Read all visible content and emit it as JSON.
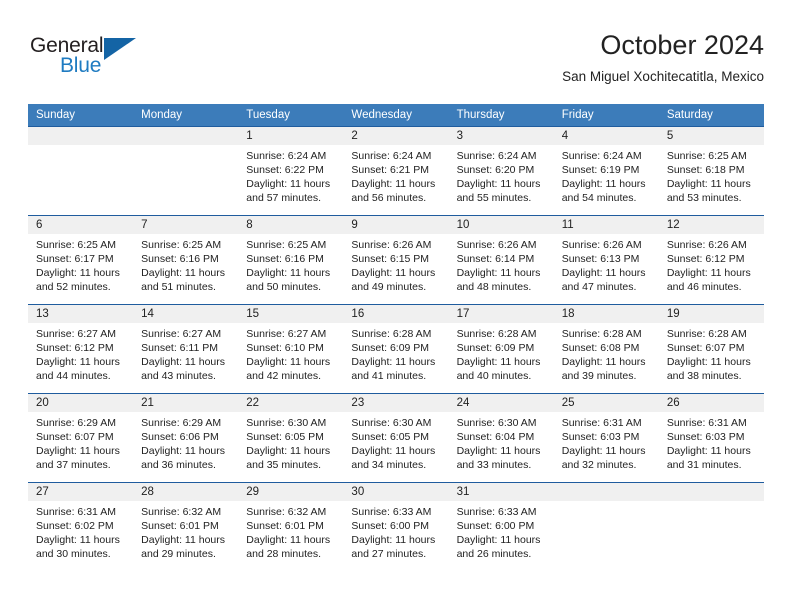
{
  "brand": {
    "name_part1": "General",
    "name_part2": "Blue",
    "accent_color": "#1f7bc1",
    "triangle_color": "#1464a5"
  },
  "header": {
    "title": "October 2024",
    "subtitle": "San Miguel Xochitecatitla, Mexico"
  },
  "calendar": {
    "header_bg": "#3c7cba",
    "row_divider_color": "#1f5c9e",
    "daynum_bg": "#f0f0f0",
    "weekday_headers": [
      "Sunday",
      "Monday",
      "Tuesday",
      "Wednesday",
      "Thursday",
      "Friday",
      "Saturday"
    ],
    "weeks": [
      [
        {
          "day": "",
          "lines": []
        },
        {
          "day": "",
          "lines": []
        },
        {
          "day": "1",
          "lines": [
            "Sunrise: 6:24 AM",
            "Sunset: 6:22 PM",
            "Daylight: 11 hours",
            "and 57 minutes."
          ]
        },
        {
          "day": "2",
          "lines": [
            "Sunrise: 6:24 AM",
            "Sunset: 6:21 PM",
            "Daylight: 11 hours",
            "and 56 minutes."
          ]
        },
        {
          "day": "3",
          "lines": [
            "Sunrise: 6:24 AM",
            "Sunset: 6:20 PM",
            "Daylight: 11 hours",
            "and 55 minutes."
          ]
        },
        {
          "day": "4",
          "lines": [
            "Sunrise: 6:24 AM",
            "Sunset: 6:19 PM",
            "Daylight: 11 hours",
            "and 54 minutes."
          ]
        },
        {
          "day": "5",
          "lines": [
            "Sunrise: 6:25 AM",
            "Sunset: 6:18 PM",
            "Daylight: 11 hours",
            "and 53 minutes."
          ]
        }
      ],
      [
        {
          "day": "6",
          "lines": [
            "Sunrise: 6:25 AM",
            "Sunset: 6:17 PM",
            "Daylight: 11 hours",
            "and 52 minutes."
          ]
        },
        {
          "day": "7",
          "lines": [
            "Sunrise: 6:25 AM",
            "Sunset: 6:16 PM",
            "Daylight: 11 hours",
            "and 51 minutes."
          ]
        },
        {
          "day": "8",
          "lines": [
            "Sunrise: 6:25 AM",
            "Sunset: 6:16 PM",
            "Daylight: 11 hours",
            "and 50 minutes."
          ]
        },
        {
          "day": "9",
          "lines": [
            "Sunrise: 6:26 AM",
            "Sunset: 6:15 PM",
            "Daylight: 11 hours",
            "and 49 minutes."
          ]
        },
        {
          "day": "10",
          "lines": [
            "Sunrise: 6:26 AM",
            "Sunset: 6:14 PM",
            "Daylight: 11 hours",
            "and 48 minutes."
          ]
        },
        {
          "day": "11",
          "lines": [
            "Sunrise: 6:26 AM",
            "Sunset: 6:13 PM",
            "Daylight: 11 hours",
            "and 47 minutes."
          ]
        },
        {
          "day": "12",
          "lines": [
            "Sunrise: 6:26 AM",
            "Sunset: 6:12 PM",
            "Daylight: 11 hours",
            "and 46 minutes."
          ]
        }
      ],
      [
        {
          "day": "13",
          "lines": [
            "Sunrise: 6:27 AM",
            "Sunset: 6:12 PM",
            "Daylight: 11 hours",
            "and 44 minutes."
          ]
        },
        {
          "day": "14",
          "lines": [
            "Sunrise: 6:27 AM",
            "Sunset: 6:11 PM",
            "Daylight: 11 hours",
            "and 43 minutes."
          ]
        },
        {
          "day": "15",
          "lines": [
            "Sunrise: 6:27 AM",
            "Sunset: 6:10 PM",
            "Daylight: 11 hours",
            "and 42 minutes."
          ]
        },
        {
          "day": "16",
          "lines": [
            "Sunrise: 6:28 AM",
            "Sunset: 6:09 PM",
            "Daylight: 11 hours",
            "and 41 minutes."
          ]
        },
        {
          "day": "17",
          "lines": [
            "Sunrise: 6:28 AM",
            "Sunset: 6:09 PM",
            "Daylight: 11 hours",
            "and 40 minutes."
          ]
        },
        {
          "day": "18",
          "lines": [
            "Sunrise: 6:28 AM",
            "Sunset: 6:08 PM",
            "Daylight: 11 hours",
            "and 39 minutes."
          ]
        },
        {
          "day": "19",
          "lines": [
            "Sunrise: 6:28 AM",
            "Sunset: 6:07 PM",
            "Daylight: 11 hours",
            "and 38 minutes."
          ]
        }
      ],
      [
        {
          "day": "20",
          "lines": [
            "Sunrise: 6:29 AM",
            "Sunset: 6:07 PM",
            "Daylight: 11 hours",
            "and 37 minutes."
          ]
        },
        {
          "day": "21",
          "lines": [
            "Sunrise: 6:29 AM",
            "Sunset: 6:06 PM",
            "Daylight: 11 hours",
            "and 36 minutes."
          ]
        },
        {
          "day": "22",
          "lines": [
            "Sunrise: 6:30 AM",
            "Sunset: 6:05 PM",
            "Daylight: 11 hours",
            "and 35 minutes."
          ]
        },
        {
          "day": "23",
          "lines": [
            "Sunrise: 6:30 AM",
            "Sunset: 6:05 PM",
            "Daylight: 11 hours",
            "and 34 minutes."
          ]
        },
        {
          "day": "24",
          "lines": [
            "Sunrise: 6:30 AM",
            "Sunset: 6:04 PM",
            "Daylight: 11 hours",
            "and 33 minutes."
          ]
        },
        {
          "day": "25",
          "lines": [
            "Sunrise: 6:31 AM",
            "Sunset: 6:03 PM",
            "Daylight: 11 hours",
            "and 32 minutes."
          ]
        },
        {
          "day": "26",
          "lines": [
            "Sunrise: 6:31 AM",
            "Sunset: 6:03 PM",
            "Daylight: 11 hours",
            "and 31 minutes."
          ]
        }
      ],
      [
        {
          "day": "27",
          "lines": [
            "Sunrise: 6:31 AM",
            "Sunset: 6:02 PM",
            "Daylight: 11 hours",
            "and 30 minutes."
          ]
        },
        {
          "day": "28",
          "lines": [
            "Sunrise: 6:32 AM",
            "Sunset: 6:01 PM",
            "Daylight: 11 hours",
            "and 29 minutes."
          ]
        },
        {
          "day": "29",
          "lines": [
            "Sunrise: 6:32 AM",
            "Sunset: 6:01 PM",
            "Daylight: 11 hours",
            "and 28 minutes."
          ]
        },
        {
          "day": "30",
          "lines": [
            "Sunrise: 6:33 AM",
            "Sunset: 6:00 PM",
            "Daylight: 11 hours",
            "and 27 minutes."
          ]
        },
        {
          "day": "31",
          "lines": [
            "Sunrise: 6:33 AM",
            "Sunset: 6:00 PM",
            "Daylight: 11 hours",
            "and 26 minutes."
          ]
        },
        {
          "day": "",
          "lines": []
        },
        {
          "day": "",
          "lines": []
        }
      ]
    ]
  }
}
